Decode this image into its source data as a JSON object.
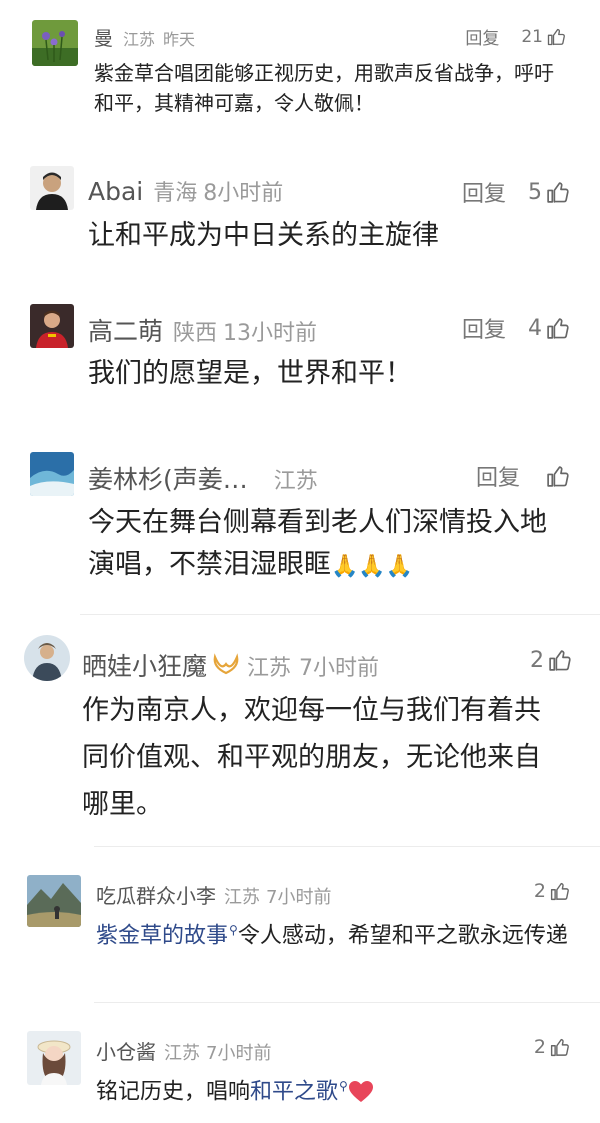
{
  "comments": [
    {
      "name": "曼",
      "location": "江苏",
      "time": "昨天",
      "reply": "回复",
      "likes": "21",
      "text": "紫金草合唱团能够正视历史，用歌声反省战争，呼吁和平，其精神可嘉，令人敬佩！"
    },
    {
      "name": "Abai",
      "location": "青海",
      "time": "8小时前",
      "reply": "回复",
      "likes": "5",
      "text": "让和平成为中日关系的主旋律"
    },
    {
      "name": "高二萌",
      "location": "陕西",
      "time": "13小时前",
      "reply": "回复",
      "likes": "4",
      "text": "我们的愿望是，世界和平！"
    },
    {
      "name": "姜林杉(声姜…",
      "location": "江苏",
      "time": "",
      "reply": "回复",
      "likes": "",
      "text": "今天在舞台侧幕看到老人们深情投入地演唱，不禁泪湿眼眶",
      "emoji": "🙏🙏🙏"
    },
    {
      "name": "晒娃小狂魔",
      "location": "江苏",
      "time": "7小时前",
      "likes": "2",
      "text": "作为南京人，欢迎每一位与我们有着共同价值观、和平观的朋友，无论他来自哪里。"
    }
  ],
  "replies": [
    {
      "name": "吃瓜群众小李",
      "location": "江苏",
      "time": "7小时前",
      "likes": "2",
      "keyword": "紫金草的故事",
      "text": "令人感动，希望和平之歌永远传递"
    },
    {
      "name": "小仓酱",
      "location": "江苏",
      "time": "7小时前",
      "likes": "2",
      "prefix": "铭记历史，唱响",
      "keyword": "和平之歌"
    }
  ],
  "colors": {
    "name": "#555555",
    "location": "#9a9a9a",
    "text": "#222222",
    "keyword": "#2f4a8a",
    "heart": "#e8455a",
    "crown": "#e6a53a"
  },
  "icons": [
    "thumb-up-icon",
    "search-icon",
    "heart-icon",
    "crown-icon"
  ]
}
